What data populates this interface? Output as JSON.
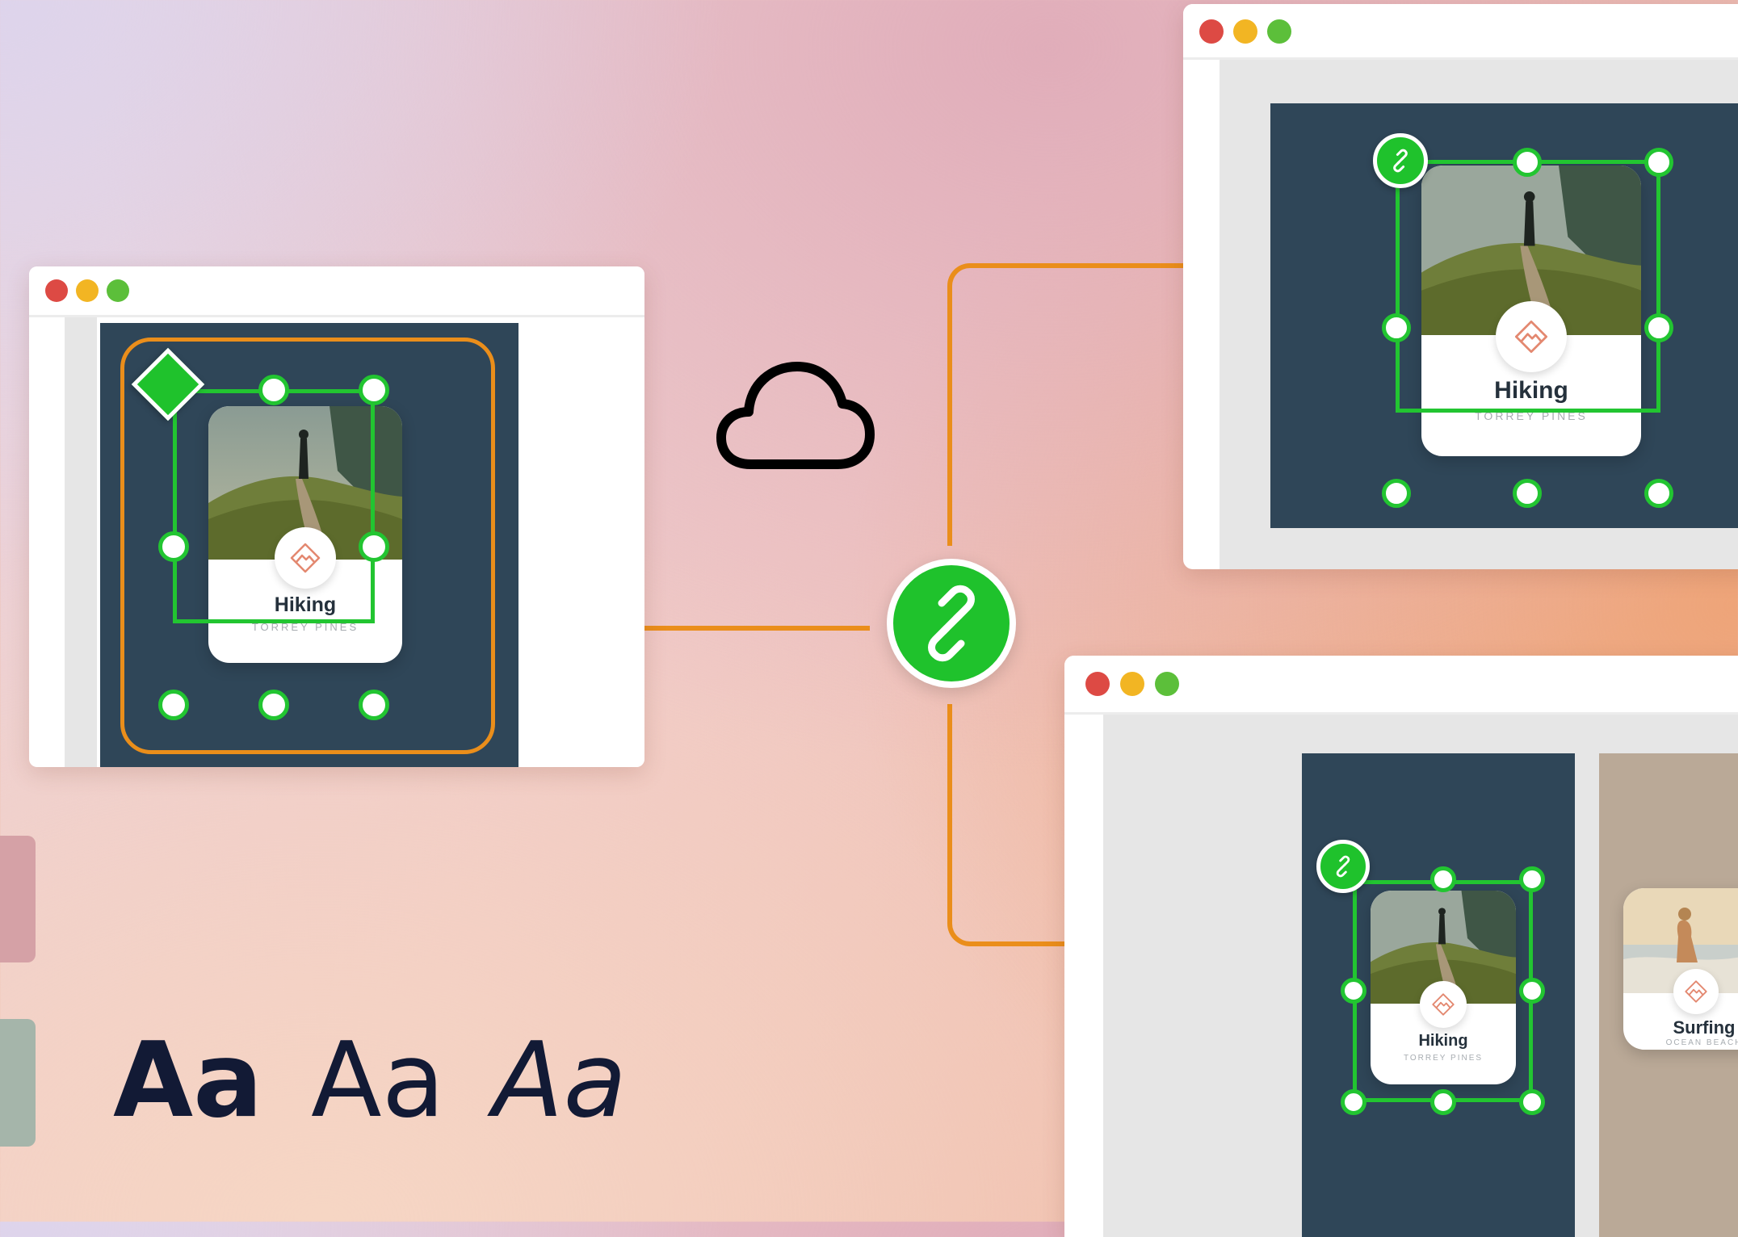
{
  "colors": {
    "selection_green": "#22c531",
    "connector_orange": "#ea8e1b",
    "card_background_navy": "#2f4658",
    "font_sample_navy": "#121a35",
    "swatch_rose": "#d5a1a6",
    "swatch_sage": "#a5b5aa"
  },
  "icons": {
    "cloud": "cloud-icon",
    "link": "link-icon",
    "symbol": "diamond-icon",
    "card_badge": "mountain-icon"
  },
  "source_window": {
    "card": {
      "title": "Hiking",
      "subtitle": "TORREY PINES"
    }
  },
  "top_window": {
    "card": {
      "title": "Hiking",
      "subtitle": "TORREY PINES"
    }
  },
  "bottom_window": {
    "card_linked": {
      "title": "Hiking",
      "subtitle": "TORREY PINES"
    },
    "card_other": {
      "title": "Surfing",
      "subtitle": "OCEAN BEACH"
    }
  },
  "typography_samples": {
    "bold": "Aa",
    "regular": "Aa",
    "light_italic": "Aa"
  }
}
